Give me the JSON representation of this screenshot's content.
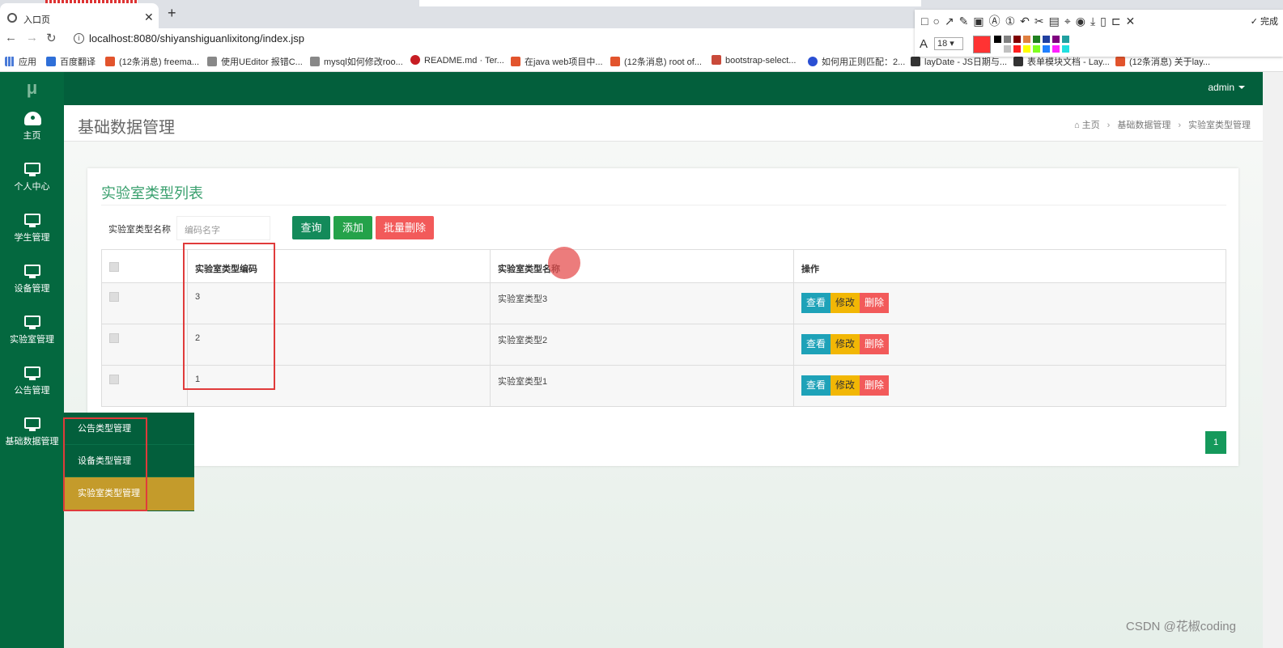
{
  "browser": {
    "tab_title": "入口页",
    "url": "localhost:8080/shiyanshiguanlixitong/index.jsp",
    "bookmarks": [
      "应用",
      "百度翻译",
      "(12条消息) freema...",
      "使用UEditor 报错C...",
      "mysql如何修改roo...",
      "README.md · Ter...",
      "在java web项目中...",
      "(12条消息) root of...",
      "bootstrap-select...",
      "如何用正则匹配：2...",
      "layDate - JS日期与...",
      "表单模块文档 - Lay...",
      "(12条消息) 关于lay..."
    ]
  },
  "snap_tool": {
    "font_size": "18",
    "done_label": "完成",
    "current_color": "#ff3333",
    "palette": [
      "#000000",
      "#808080",
      "#800000",
      "#e08040",
      "#208020",
      "#2040a0",
      "#800080",
      "#20a0a0",
      "#ffffff",
      "#c0c0c0",
      "#ff2020",
      "#ffff00",
      "#80ff20",
      "#2080ff",
      "#ff20ff",
      "#20e0e0"
    ]
  },
  "app": {
    "logo": "μ",
    "user": "admin",
    "sidebar": [
      {
        "label": "主页",
        "icon": "dashboard-icon"
      },
      {
        "label": "个人中心",
        "icon": "monitor-icon"
      },
      {
        "label": "学生管理",
        "icon": "monitor-icon"
      },
      {
        "label": "设备管理",
        "icon": "monitor-icon"
      },
      {
        "label": "实验室管理",
        "icon": "monitor-icon"
      },
      {
        "label": "公告管理",
        "icon": "monitor-icon"
      },
      {
        "label": "基础数据管理",
        "icon": "monitor-icon"
      }
    ],
    "submenu": [
      "公告类型管理",
      "设备类型管理",
      "实验室类型管理"
    ],
    "page_title": "基础数据管理",
    "breadcrumb": [
      "主页",
      "基础数据管理",
      "实验室类型管理"
    ],
    "card_title": "实验室类型列表",
    "search": {
      "label": "实验室类型名称",
      "placeholder": "编码名字"
    },
    "buttons": {
      "query": "查询",
      "add": "添加",
      "batch_delete": "批量删除"
    },
    "table": {
      "headers": [
        "实验室类型编码",
        "实验室类型名称",
        "操作"
      ],
      "rows": [
        {
          "code": "3",
          "name": "实验室类型3"
        },
        {
          "code": "2",
          "name": "实验室类型2"
        },
        {
          "code": "1",
          "name": "实验室类型1"
        }
      ],
      "actions": {
        "view": "查看",
        "edit": "修改",
        "delete": "删除"
      }
    },
    "pagination": [
      "1"
    ],
    "watermark": "CSDN @花椒coding"
  },
  "colors": {
    "nav": "#035f3c",
    "sidebar": "#04683f",
    "active_submenu": "#c49b2b",
    "query_btn": "#138a5a",
    "add_btn": "#24a24a",
    "delete_btn": "#f25a5a",
    "view_btn": "#1ea2b8",
    "edit_btn": "#f2b705",
    "annotation_box": "#e03b3b"
  }
}
